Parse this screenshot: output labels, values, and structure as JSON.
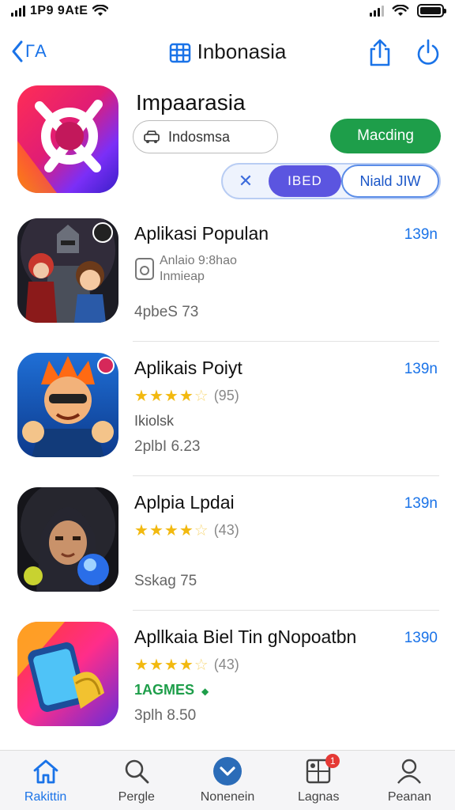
{
  "status_bar": {
    "time": "1P9 9AtE"
  },
  "nav": {
    "back_label": "ΓA",
    "title": "Inbonasia"
  },
  "app": {
    "name": "Impaarasia",
    "search_text": "Indosmsa",
    "get_label": "Macding",
    "segment_close": "✕",
    "segment_active": "IBED",
    "segment_other": "Niald JIW"
  },
  "list": [
    {
      "title": "Aplikasi Populan",
      "price": "139n",
      "ghost_line1": "Anlaio 9:8hao",
      "ghost_line2": "Inmieap",
      "meta": "4pbeS 73"
    },
    {
      "title": "Aplikais Poiyt",
      "price": "139n",
      "stars": 4.5,
      "rating_count": "(95)",
      "sub": "Ikiolsk",
      "meta": "2plbI 6.23"
    },
    {
      "title": "Aplpia Lpdai",
      "price": "139n",
      "stars": 4.5,
      "rating_count": "(43)",
      "meta": "Sskag 75"
    },
    {
      "title": "Apllkaia Biel Tin gNopoatbn",
      "price": "1390",
      "stars": 4.5,
      "rating_count": "(43)",
      "sub": "1AGMES",
      "meta": "3plh 8.50"
    }
  ],
  "tabs": [
    {
      "label": "Rakittin",
      "icon": "home-icon"
    },
    {
      "label": "Pergle",
      "icon": "search-icon"
    },
    {
      "label": "Nonenein",
      "icon": "chevron-down-circle-icon"
    },
    {
      "label": "Lagnas",
      "icon": "grid-icon",
      "badge": "1"
    },
    {
      "label": "Peanan",
      "icon": "person-icon"
    }
  ],
  "colors": {
    "accent": "#1a73e8",
    "get_green": "#1e9e4a",
    "segment_purple": "#5b55e0",
    "star": "#f2b90f"
  }
}
